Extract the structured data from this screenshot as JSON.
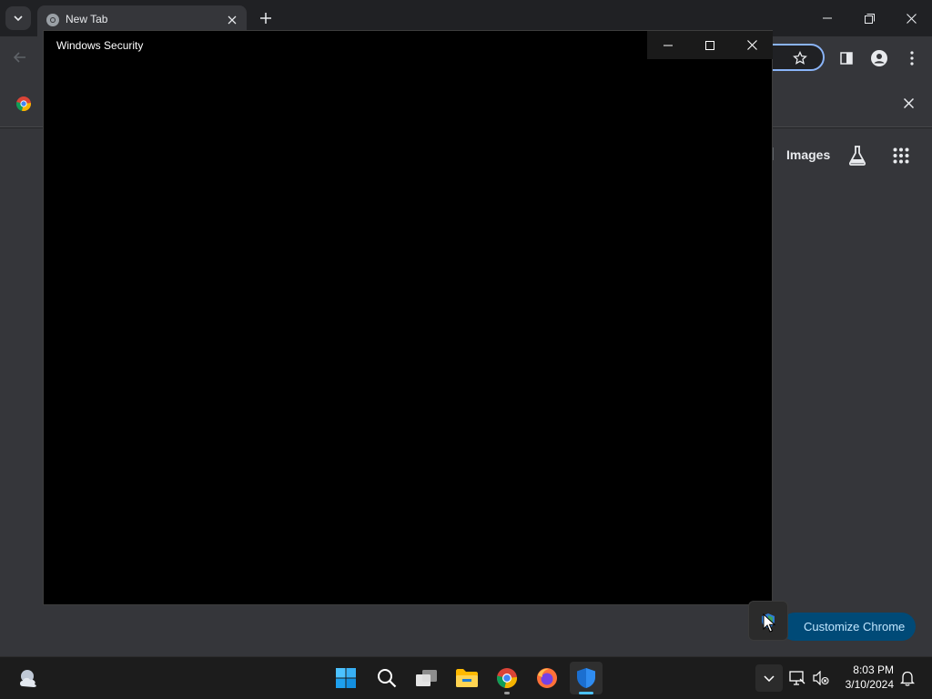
{
  "browser": {
    "tab": {
      "title": "New Tab"
    },
    "window_controls": [
      "minimize",
      "restore",
      "close"
    ],
    "toolbar": {
      "icons": [
        "back-icon",
        "star-icon",
        "side-panel-icon",
        "profile-icon",
        "menu-icon"
      ]
    }
  },
  "ntp": {
    "images_link": "Images",
    "customize_label": "Customize Chrome"
  },
  "security_window": {
    "title": "Windows Security"
  },
  "taskbar": {
    "apps": [
      "windows-start",
      "search",
      "task-view",
      "file-explorer",
      "chrome",
      "firefox",
      "windows-security"
    ],
    "clock_time": "8:03 PM",
    "clock_date": "3/10/2024"
  },
  "colors": {
    "chrome_dark": "#202124",
    "chrome_surface": "#35363a",
    "accent_blue": "#8ab4f8",
    "customize_bg": "#004a77",
    "taskbar": "#1c1c1c"
  }
}
